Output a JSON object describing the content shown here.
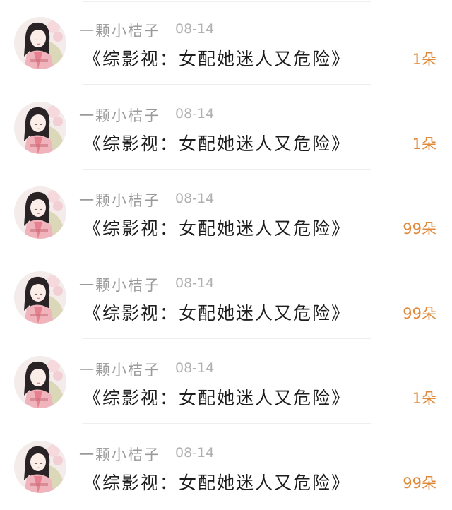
{
  "gift_list": {
    "items": [
      {
        "user": "一颗小桔子",
        "date": "08-14",
        "book": "《综影视：女配她迷人又危险》",
        "count": "1朵",
        "avatar_icon": "girl-avatar-icon"
      },
      {
        "user": "一颗小桔子",
        "date": "08-14",
        "book": "《综影视：女配她迷人又危险》",
        "count": "1朵",
        "avatar_icon": "girl-avatar-icon"
      },
      {
        "user": "一颗小桔子",
        "date": "08-14",
        "book": "《综影视：女配她迷人又危险》",
        "count": "99朵",
        "avatar_icon": "girl-avatar-icon"
      },
      {
        "user": "一颗小桔子",
        "date": "08-14",
        "book": "《综影视：女配她迷人又危险》",
        "count": "99朵",
        "avatar_icon": "girl-avatar-icon"
      },
      {
        "user": "一颗小桔子",
        "date": "08-14",
        "book": "《综影视：女配她迷人又危险》",
        "count": "1朵",
        "avatar_icon": "girl-avatar-icon"
      },
      {
        "user": "一颗小桔子",
        "date": "08-14",
        "book": "《综影视：女配她迷人又危险》",
        "count": "99朵",
        "avatar_icon": "girl-avatar-icon"
      }
    ]
  },
  "colors": {
    "count_accent": "#e08a3c",
    "username": "#9a9a9a",
    "date": "#b0b0b0",
    "title": "#1d1d1d"
  }
}
